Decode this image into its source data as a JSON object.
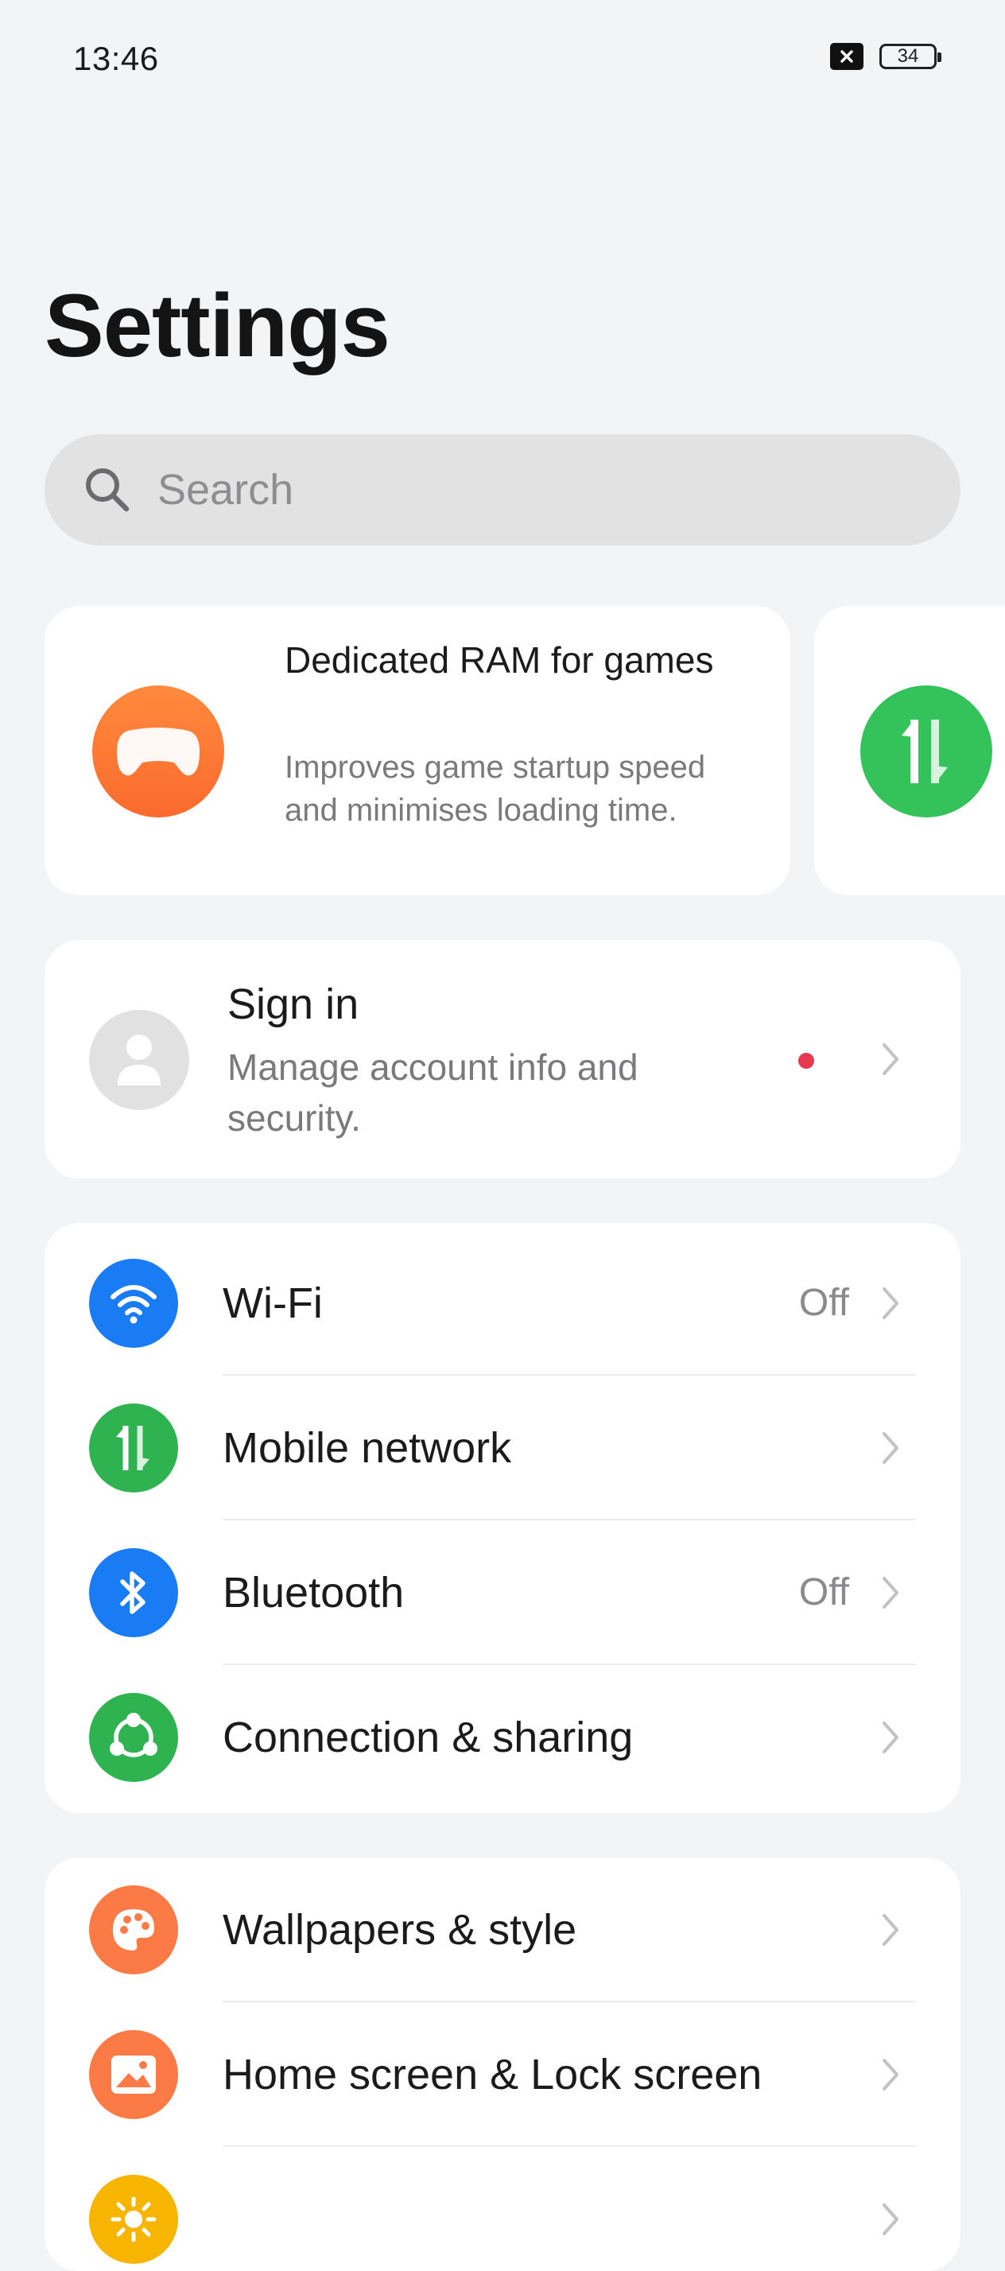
{
  "status_bar": {
    "time": "13:46",
    "battery": "34",
    "icons": [
      "sim-off-icon",
      "battery-icon"
    ]
  },
  "page": {
    "title": "Settings"
  },
  "search": {
    "placeholder": "Search",
    "icon": "search-icon"
  },
  "promo_cards": [
    {
      "title": "Dedicated RAM for games",
      "description": "Improves game startup speed and minimises loading time.",
      "icon": "gamepad-icon",
      "color": "#fb7a32"
    },
    {
      "icon": "data-arrows-icon",
      "color": "#34c25a"
    }
  ],
  "account": {
    "title": "Sign in",
    "subtitle": "Manage account info and security.",
    "icon": "person-icon",
    "badge_color": "#e53950"
  },
  "connectivity": [
    {
      "label": "Wi-Fi",
      "value": "Off",
      "icon": "wifi-icon",
      "color": "#1a7cf5"
    },
    {
      "label": "Mobile network",
      "value": "",
      "icon": "mobile-data-icon",
      "color": "#2eb350"
    },
    {
      "label": "Bluetooth",
      "value": "Off",
      "icon": "bluetooth-icon",
      "color": "#1a7cf5"
    },
    {
      "label": "Connection & sharing",
      "value": "",
      "icon": "share-icon",
      "color": "#2eb350"
    }
  ],
  "personalization": [
    {
      "label": "Wallpapers & style",
      "value": "",
      "icon": "palette-icon",
      "color": "#fb7a46"
    },
    {
      "label": "Home screen & Lock screen",
      "value": "",
      "icon": "image-icon",
      "color": "#fb7a46"
    },
    {
      "label": "",
      "value": "",
      "icon": "sun-icon",
      "color": "#f7b500"
    }
  ]
}
